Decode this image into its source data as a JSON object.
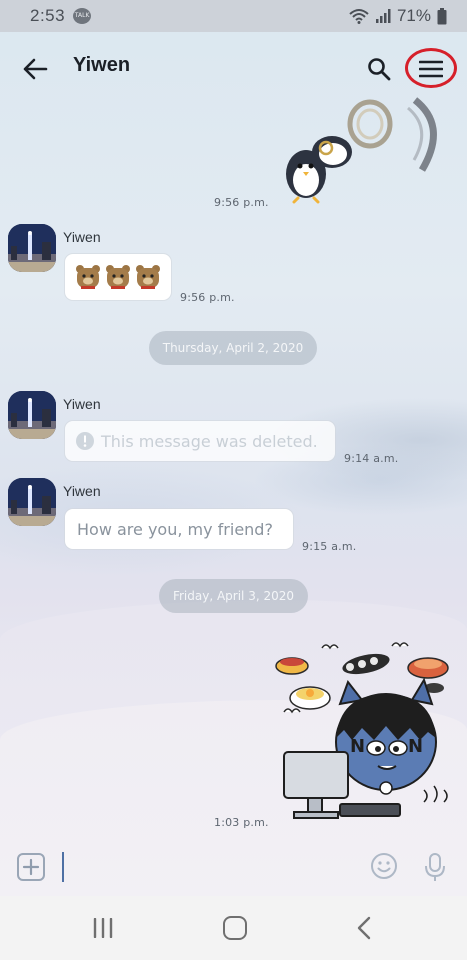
{
  "status_bar": {
    "time": "2:53",
    "talk_badge": "TALK",
    "battery": "71%"
  },
  "header": {
    "title": "Yiwen",
    "back_icon": "arrow-left-icon",
    "search_icon": "search-icon",
    "menu_icon": "hamburger-menu-icon",
    "highlight_color": "#d6202a"
  },
  "messages": [
    {
      "type": "sticker",
      "side": "right",
      "sticker": "penguin-with-ring-sticker",
      "time": "9:56 p.m."
    },
    {
      "type": "stickers",
      "side": "left",
      "sender": "Yiwen",
      "stickers": [
        "bear-face-emoticon",
        "bear-face-emoticon",
        "bear-face-emoticon"
      ],
      "time": "9:56 p.m."
    },
    {
      "type": "date",
      "label": "Thursday, April 2, 2020"
    },
    {
      "type": "text",
      "side": "left",
      "sender": "Yiwen",
      "text": "This message was deleted.",
      "deleted": true,
      "time": "9:14 a.m."
    },
    {
      "type": "text",
      "side": "left",
      "sender": "Yiwen",
      "text": "How are you, my friend?",
      "time": "9:15 a.m."
    },
    {
      "type": "date",
      "label": "Friday, April 3, 2020"
    },
    {
      "type": "sticker",
      "side": "right",
      "sticker": "cat-eating-at-computer-sticker",
      "time": "1:03 p.m."
    }
  ],
  "input_bar": {
    "plus_icon": "plus-icon",
    "emoji_icon": "emoji-icon",
    "mic_icon": "microphone-icon",
    "value": ""
  },
  "nav_bar": {
    "recent_icon": "recent-apps-icon",
    "home_icon": "home-icon",
    "back_icon": "back-chevron-icon"
  }
}
